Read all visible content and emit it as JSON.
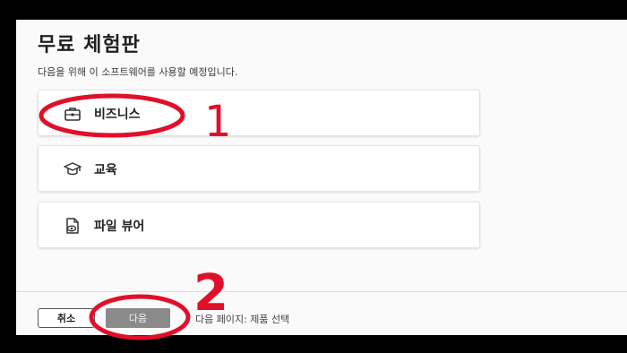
{
  "dialog": {
    "title": "무료 체험판",
    "subtitle": "다음을 위해 이 소프트웨어를 사용할 예정입니다."
  },
  "options": [
    {
      "label": "비즈니스",
      "icon": "briefcase-icon"
    },
    {
      "label": "교육",
      "icon": "graduation-cap-icon"
    },
    {
      "label": "파일 뷰어",
      "icon": "file-viewer-icon"
    }
  ],
  "footer": {
    "cancel_label": "취소",
    "next_label": "다음",
    "next_hint": "다음 페이지: 제품 선택"
  },
  "annotations": {
    "marker_1": "1",
    "marker_2": "2",
    "color": "#e0102a"
  }
}
